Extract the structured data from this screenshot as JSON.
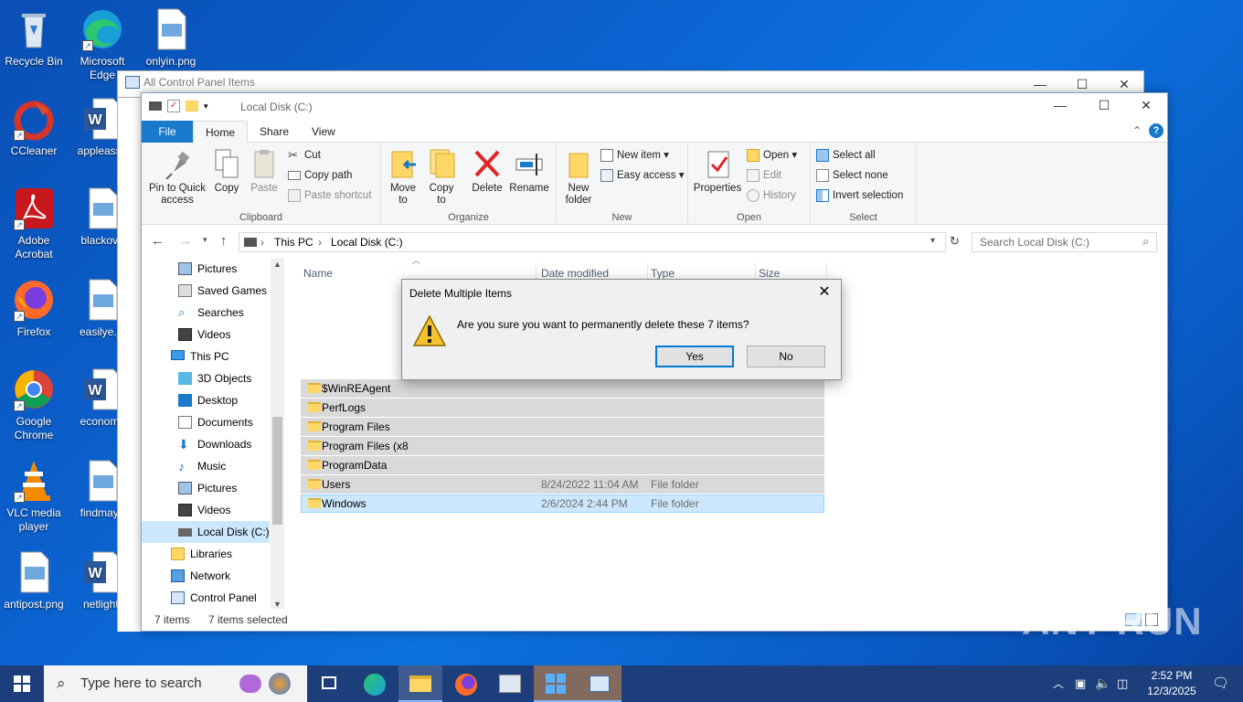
{
  "desktop": {
    "icons": [
      {
        "label": "Recycle Bin"
      },
      {
        "label": "Microsoft Edge"
      },
      {
        "label": "onlyin.png"
      },
      {
        "label": "CCleaner"
      },
      {
        "label": "appleasso"
      },
      {
        "label": "Adobe Acrobat"
      },
      {
        "label": "blackove"
      },
      {
        "label": "Firefox"
      },
      {
        "label": "easilye.jp"
      },
      {
        "label": "Google Chrome"
      },
      {
        "label": "economy"
      },
      {
        "label": "VLC media player"
      },
      {
        "label": "findmayb"
      },
      {
        "label": "antipost.png"
      },
      {
        "label": "netlight."
      }
    ]
  },
  "back_window": {
    "title": "All Control Panel Items"
  },
  "explorer": {
    "title": "Local Disk (C:)",
    "tabs": {
      "file": "File",
      "home": "Home",
      "share": "Share",
      "view": "View"
    },
    "ribbon": {
      "clipboard": {
        "label": "Clipboard",
        "pin": "Pin to Quick access",
        "copy": "Copy",
        "paste": "Paste",
        "cut": "Cut",
        "copy_path": "Copy path",
        "paste_shortcut": "Paste shortcut"
      },
      "organize": {
        "label": "Organize",
        "move_to": "Move to",
        "copy_to": "Copy to",
        "delete": "Delete",
        "rename": "Rename"
      },
      "new": {
        "label": "New",
        "new_folder": "New folder",
        "new_item": "New item",
        "easy_access": "Easy access"
      },
      "open": {
        "label": "Open",
        "properties": "Properties",
        "open": "Open",
        "edit": "Edit",
        "history": "History"
      },
      "select": {
        "label": "Select",
        "select_all": "Select all",
        "select_none": "Select none",
        "invert": "Invert selection"
      }
    },
    "address": {
      "this_pc": "This PC",
      "local_disk": "Local Disk (C:)"
    },
    "search_placeholder": "Search Local Disk (C:)",
    "nav": [
      {
        "label": "Pictures"
      },
      {
        "label": "Saved Games"
      },
      {
        "label": "Searches"
      },
      {
        "label": "Videos"
      },
      {
        "label": "This PC"
      },
      {
        "label": "3D Objects"
      },
      {
        "label": "Desktop"
      },
      {
        "label": "Documents"
      },
      {
        "label": "Downloads"
      },
      {
        "label": "Music"
      },
      {
        "label": "Pictures"
      },
      {
        "label": "Videos"
      },
      {
        "label": "Local Disk (C:)"
      },
      {
        "label": "Libraries"
      },
      {
        "label": "Network"
      },
      {
        "label": "Control Panel"
      }
    ],
    "columns": {
      "name": "Name",
      "date": "Date modified",
      "type": "Type",
      "size": "Size"
    },
    "files": [
      {
        "name": "$WinREAgent",
        "date": "",
        "type": ""
      },
      {
        "name": "PerfLogs",
        "date": "",
        "type": ""
      },
      {
        "name": "Program Files",
        "date": "",
        "type": ""
      },
      {
        "name": "Program Files (x8",
        "date": "",
        "type": ""
      },
      {
        "name": "ProgramData",
        "date": "",
        "type": ""
      },
      {
        "name": "Users",
        "date": "8/24/2022 11:04 AM",
        "type": "File folder"
      },
      {
        "name": "Windows",
        "date": "2/6/2024 2:44 PM",
        "type": "File folder"
      }
    ],
    "status": {
      "count": "7 items",
      "selected": "7 items selected"
    }
  },
  "dialog": {
    "title": "Delete Multiple Items",
    "message": "Are you sure you want to permanently delete these 7 items?",
    "yes": "Yes",
    "no": "No"
  },
  "taskbar": {
    "search_placeholder": "Type here to search",
    "time": "2:52 PM",
    "date": "12/3/2025"
  },
  "watermark": "ANY RUN"
}
